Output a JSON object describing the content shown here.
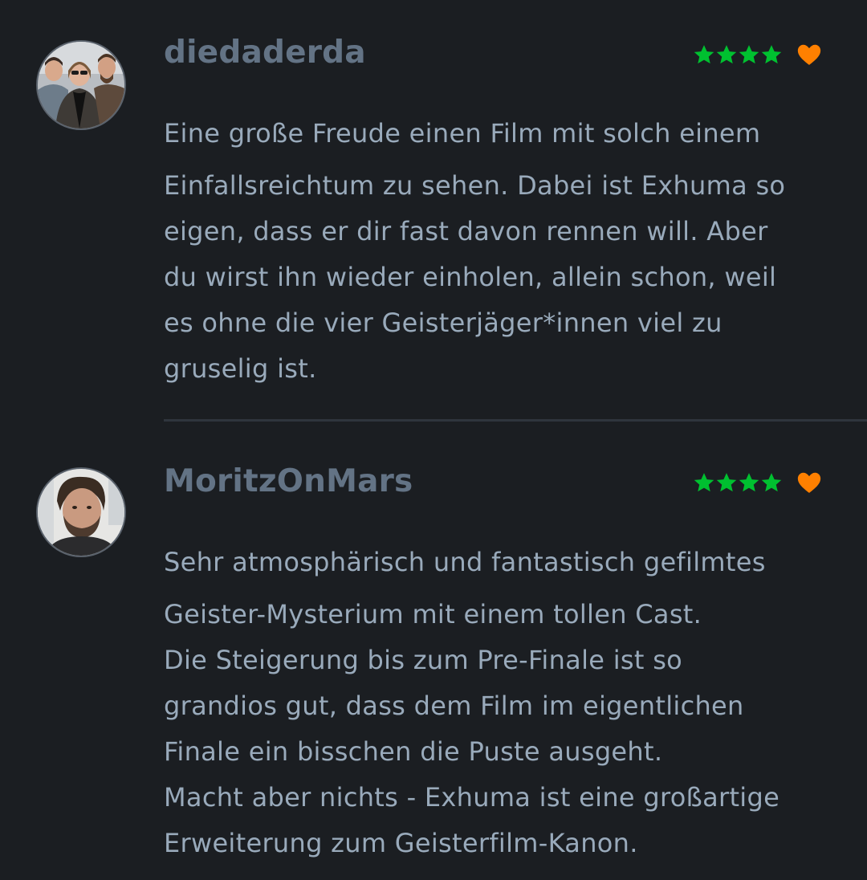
{
  "colors": {
    "background": "#1b1e22",
    "username": "#637385",
    "body_text": "#99aabb",
    "star": "#00c030",
    "like": "#ff8000",
    "divider": "#2f353d"
  },
  "reviews": [
    {
      "username": "diedaderda",
      "stars": 4,
      "liked": true,
      "avatar_icon": "group-photo-avatar",
      "lines": [
        "Eine große Freude einen Film mit solch einem",
        "Einfallsreichtum zu sehen. Dabei ist Exhuma so",
        "eigen, dass er dir fast davon rennen will. Aber",
        "du wirst ihn wieder einholen, allein schon, weil",
        "es ohne die vier Geisterjäger*innen viel zu",
        "gruselig ist."
      ]
    },
    {
      "username": "MoritzOnMars",
      "stars": 4,
      "liked": true,
      "avatar_icon": "portrait-photo-avatar",
      "lines": [
        "Sehr atmosphärisch und fantastisch gefilmtes",
        "Geister-Mysterium mit einem tollen Cast.",
        "Die Steigerung bis zum Pre-Finale ist so",
        "grandios gut, dass dem Film im eigentlichen",
        "Finale ein bisschen die Puste ausgeht.",
        "Macht aber nichts - Exhuma ist eine großartige",
        "Erweiterung zum Geisterfilm-Kanon."
      ]
    }
  ]
}
